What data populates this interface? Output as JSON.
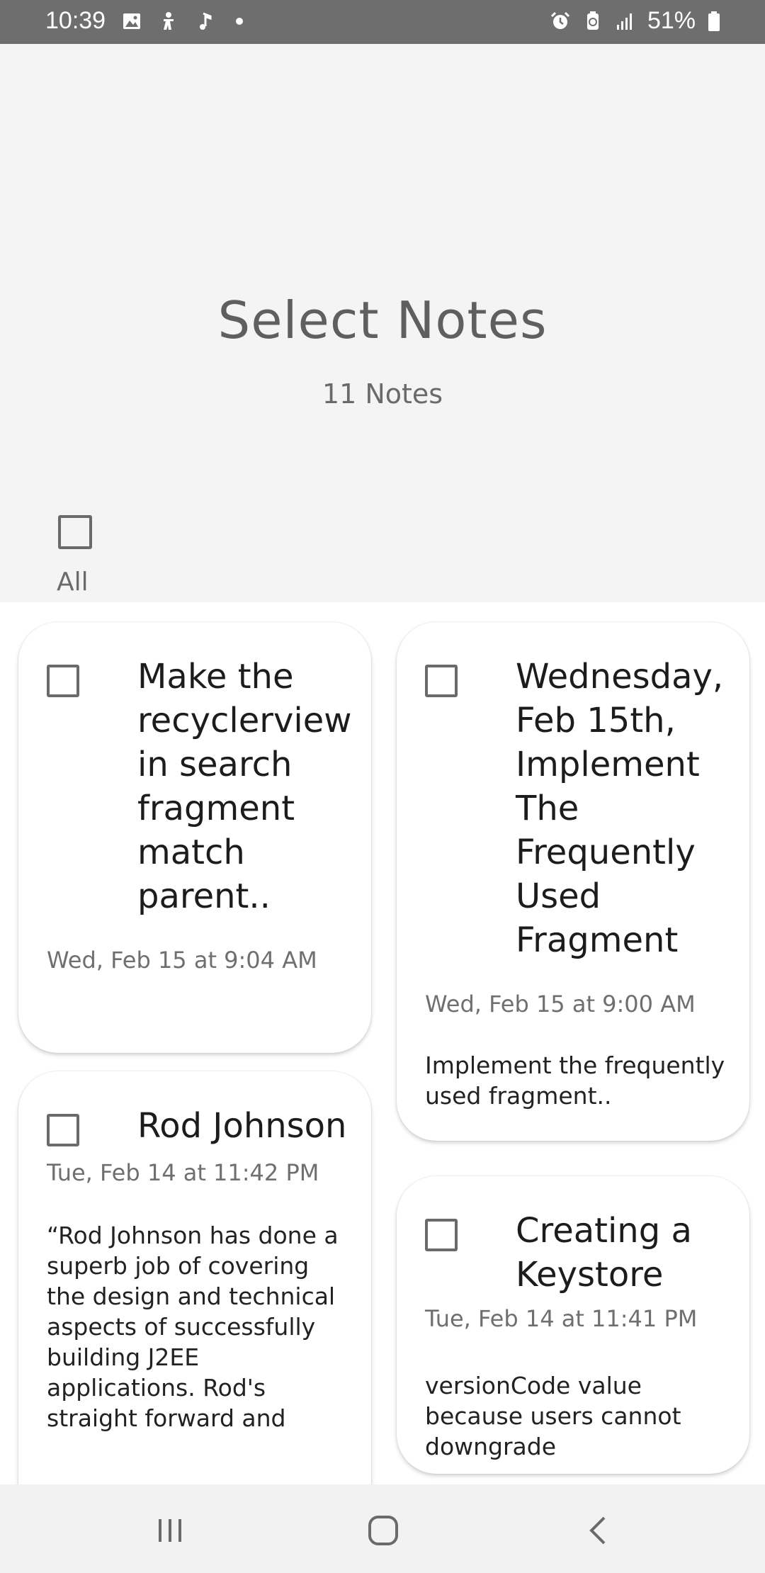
{
  "status_bar": {
    "time": "10:39",
    "battery": "51%",
    "icons": [
      "image-icon",
      "accessibility-icon",
      "music-note-icon",
      "dot-icon",
      "alarm-icon",
      "battery-saver-icon",
      "signal-icon",
      "battery-icon"
    ]
  },
  "header": {
    "title": "Select Notes",
    "count": "11 Notes",
    "select_all_label": "All"
  },
  "notes": [
    {
      "title": "Make the recyclerview in search fragment match parent..",
      "date": "Wed, Feb 15 at 9:04 AM",
      "body": ""
    },
    {
      "title": "Wednesday, Feb 15th, Implement The Frequently Used Fragment",
      "date": "Wed, Feb 15 at 9:00 AM",
      "body": "Implement the frequently used fragment.."
    },
    {
      "title": "Rod Johnson",
      "date": "Tue, Feb 14 at 11:42 PM",
      "body": "“Rod Johnson has done a superb job of covering the design and technical aspects of successfully building J2EE applications. Rod's straight forward and"
    },
    {
      "title": "Creating a Keystore",
      "date": "Tue, Feb 14 at 11:41 PM",
      "body": "versionCode value because users cannot downgrade"
    }
  ],
  "nav_bar": {
    "buttons": [
      "recent-apps",
      "home",
      "back"
    ]
  },
  "colors": {
    "status_bar": "#6e6e6e",
    "header_bg": "#f4f4f4",
    "card_bg": "#ffffff",
    "muted_text": "#6a6a6a"
  }
}
